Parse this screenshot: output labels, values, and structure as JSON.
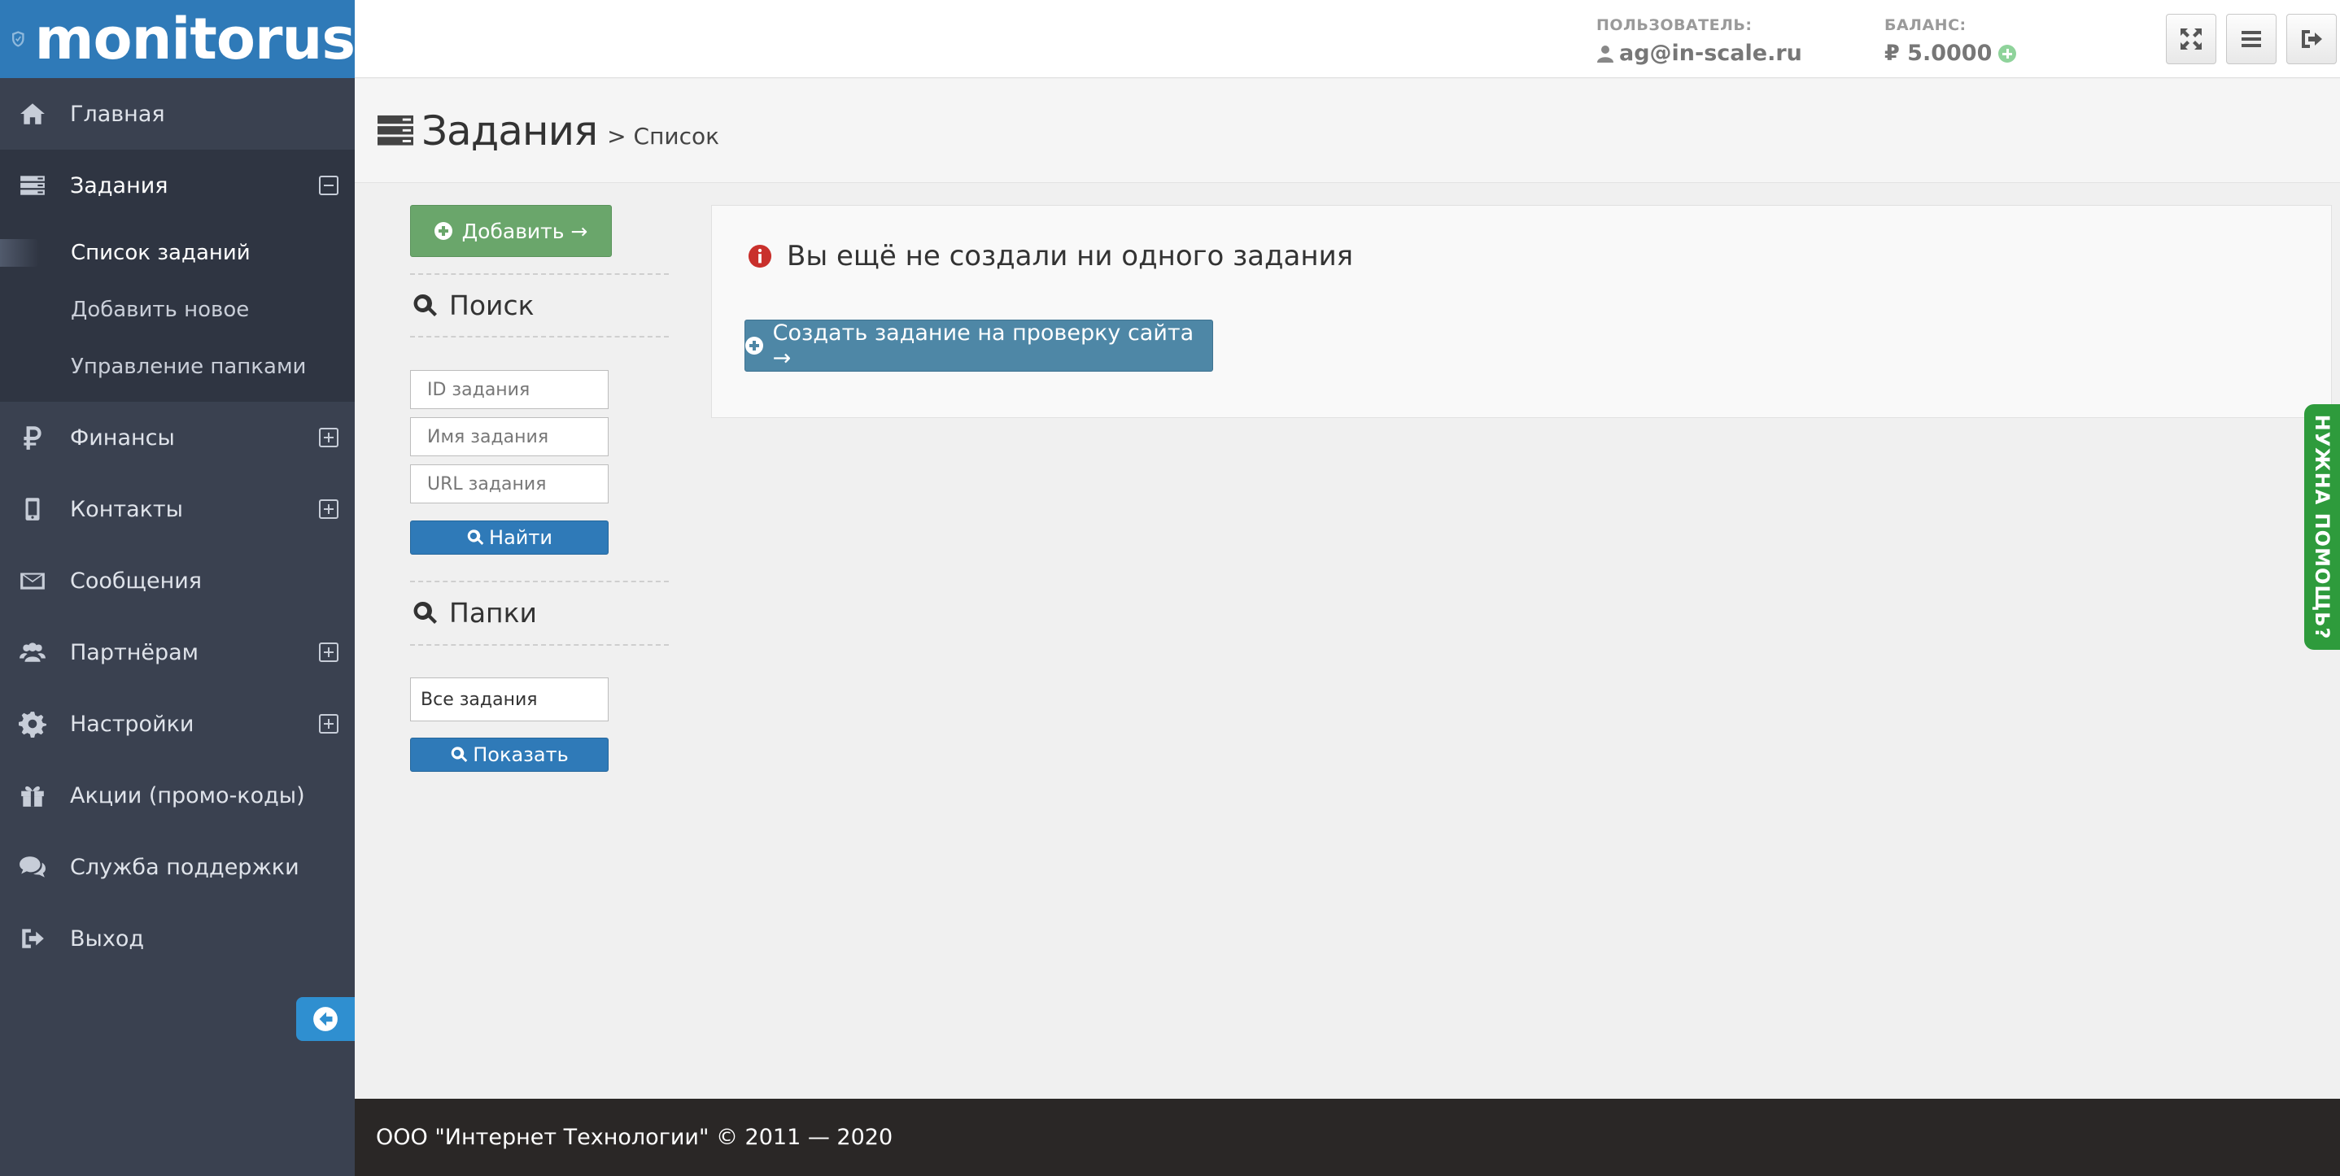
{
  "app": {
    "logo_text": "monitorus"
  },
  "sidebar": {
    "items": [
      {
        "label": "Главная",
        "icon": "home-icon"
      },
      {
        "label": "Задания",
        "icon": "tasks-icon",
        "expanded": true
      },
      {
        "label": "Финансы",
        "icon": "ruble-icon"
      },
      {
        "label": "Контакты",
        "icon": "mobile-icon"
      },
      {
        "label": "Сообщения",
        "icon": "envelope-icon"
      },
      {
        "label": "Партнёрам",
        "icon": "users-icon"
      },
      {
        "label": "Настройки",
        "icon": "gear-icon"
      },
      {
        "label": "Акции (промо-коды)",
        "icon": "gift-icon"
      },
      {
        "label": "Служба поддержки",
        "icon": "comments-icon"
      },
      {
        "label": "Выход",
        "icon": "sign-out-icon"
      }
    ],
    "subitems": [
      {
        "label": "Список заданий"
      },
      {
        "label": "Добавить новое"
      },
      {
        "label": "Управление папками"
      }
    ]
  },
  "topbar": {
    "user_label": "ПОЛЬЗОВАТЕЛЬ:",
    "user_value": "ag@in-scale.ru",
    "balance_label": "БАЛАНС:",
    "balance_value": "₽ 5.0000"
  },
  "page": {
    "title": "Задания",
    "subtitle": "> Список"
  },
  "filters": {
    "add_label": "Добавить →",
    "search_heading": "Поиск",
    "id_placeholder": "ID задания",
    "name_placeholder": "Имя задания",
    "url_placeholder": "URL задания",
    "find_label": "Найти",
    "folders_heading": "Папки",
    "folder_selected": "Все задания",
    "show_label": "Показать"
  },
  "main": {
    "empty_message": "Вы ещё не создали ни одного задания",
    "create_label": "Создать задание на проверку сайта →"
  },
  "help_tab": "НУЖНА ПОМОЩЬ?",
  "footer": {
    "text": "ООО \"Интернет Технологии\" © 2011 — 2020"
  },
  "colors": {
    "sidebar_bg": "#3a4150",
    "logo_bg": "#2f7ab8",
    "add_button": "#6aa66b",
    "primary_button": "#2f7ab8",
    "create_button": "#4e87a6",
    "help_tab": "#2e9b3c",
    "footer_bg": "#2a2726"
  }
}
